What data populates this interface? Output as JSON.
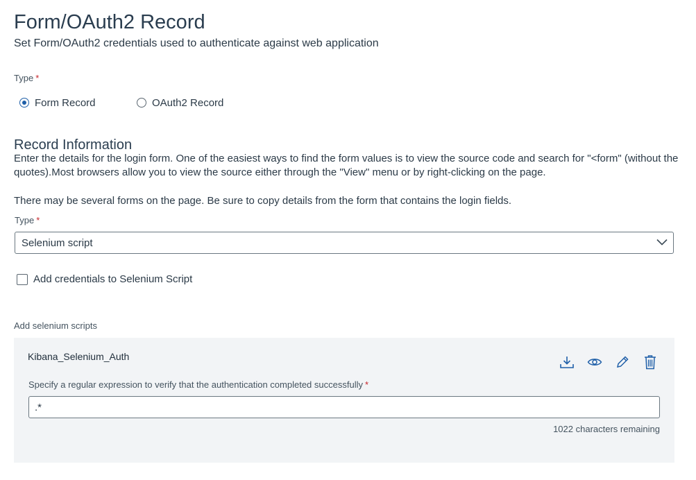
{
  "header": {
    "title": "Form/OAuth2 Record",
    "subtitle": "Set Form/OAuth2 credentials used to authenticate against web application"
  },
  "type_field": {
    "label": "Type",
    "required_mark": "*",
    "options": [
      {
        "label": "Form Record",
        "checked": true
      },
      {
        "label": "OAuth2 Record",
        "checked": false
      }
    ]
  },
  "record_info": {
    "title": "Record Information",
    "description": "Enter the details for the login form. One of the easiest ways to find the form values is to view the source code and search for \"<form\" (without the quotes).Most browsers allow you to view the source either through the \"View\" menu or by right-clicking on the page.",
    "note": "There may be several forms on the page. Be sure to copy details from the form that contains the login fields.",
    "type_label": "Type",
    "required_mark": "*",
    "type_value": "Selenium script",
    "checkbox_label": "Add credentials to Selenium Script",
    "checkbox_checked": false
  },
  "selenium": {
    "section_label": "Add selenium scripts",
    "script_name": "Kibana_Selenium_Auth",
    "icons": [
      "download-icon",
      "eye-icon",
      "pencil-icon",
      "trash-icon"
    ],
    "regex_label": "Specify a regular expression to verify that the authentication completed successfully",
    "required_mark": "*",
    "regex_value": ".*",
    "remaining": "1022 characters remaining"
  },
  "colors": {
    "accent": "#1f5fa8",
    "required": "#c6252b",
    "panel_bg": "#f2f4f6",
    "text": "#2b3a47"
  }
}
